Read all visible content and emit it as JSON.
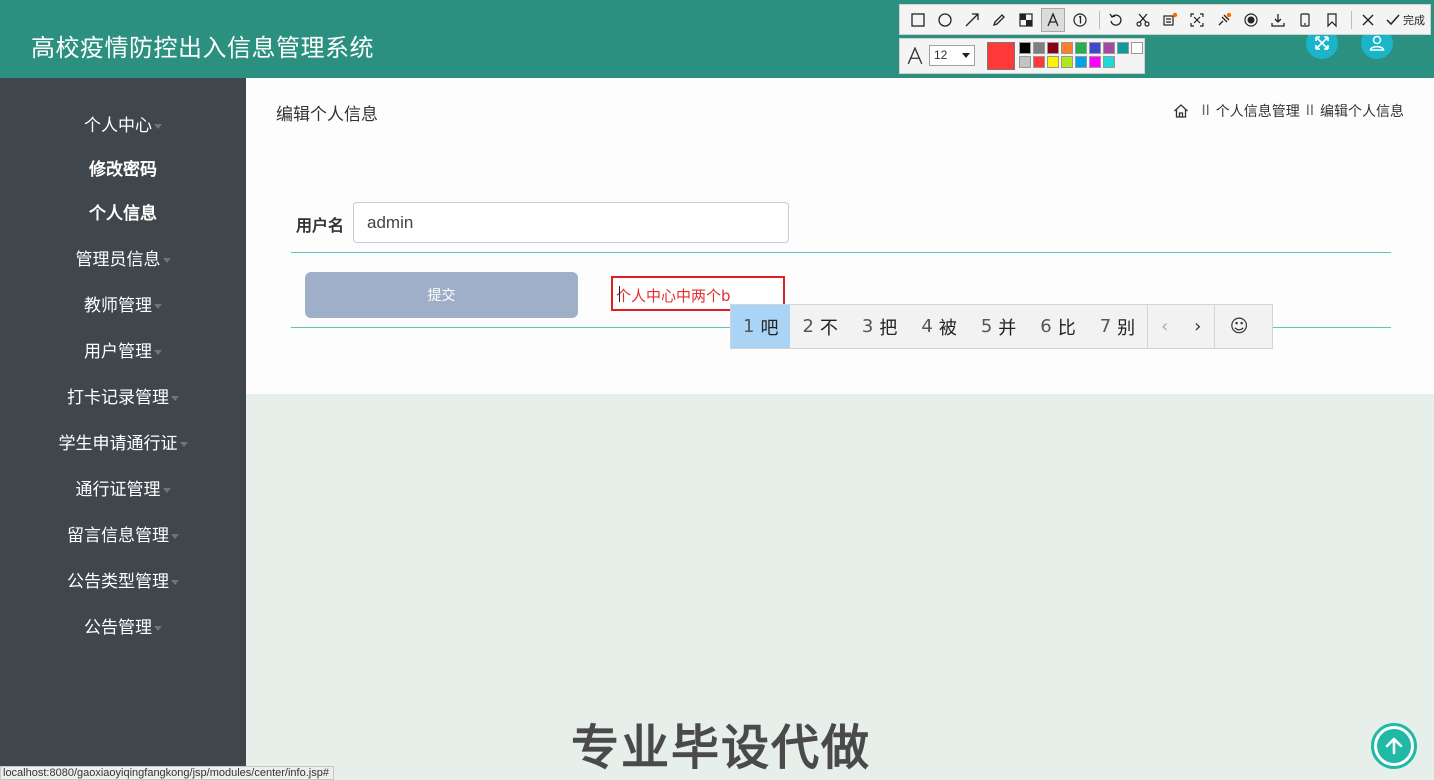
{
  "header": {
    "title": "高校疫情防控出入信息管理系统",
    "fullscreen_icon": "expand-arrows-icon",
    "user_icon": "user-icon"
  },
  "snip_toolbar": {
    "tools": [
      "rectangle-icon",
      "ellipse-icon",
      "arrow-icon",
      "pen-icon",
      "mosaic-icon",
      "text-icon",
      "number-icon",
      "undo-icon",
      "cut-icon",
      "ocr-icon",
      "scan-icon",
      "pin-icon",
      "record-icon",
      "download-icon",
      "phone-icon",
      "bookmark-icon"
    ],
    "done_label": "完成",
    "font_size": "12",
    "current_color": "#ff3838",
    "palette": [
      "#000000",
      "#7f7f7f",
      "#880015",
      "#ff7f27",
      "#22b14c",
      "#3f48cc",
      "#a349a4",
      "#0f9b9b",
      "#ffffff",
      "#c3c3c3",
      "#ff3838",
      "#fff200",
      "#b5e61d",
      "#00a2e8",
      "#ff00ff",
      "#1fd8d8"
    ]
  },
  "sidebar": {
    "items": [
      {
        "label": "个人中心",
        "caret": true,
        "sub": false
      },
      {
        "label": "修改密码",
        "caret": false,
        "sub": true
      },
      {
        "label": "个人信息",
        "caret": false,
        "sub": true
      },
      {
        "label": "管理员信息",
        "caret": true,
        "sub": false
      },
      {
        "label": "教师管理",
        "caret": true,
        "sub": false
      },
      {
        "label": "用户管理",
        "caret": true,
        "sub": false
      },
      {
        "label": "打卡记录管理",
        "caret": true,
        "sub": false
      },
      {
        "label": "学生申请通行证",
        "caret": true,
        "sub": false
      },
      {
        "label": "通行证管理",
        "caret": true,
        "sub": false
      },
      {
        "label": "留言信息管理",
        "caret": true,
        "sub": false
      },
      {
        "label": "公告类型管理",
        "caret": true,
        "sub": false
      },
      {
        "label": "公告管理",
        "caret": true,
        "sub": false
      }
    ]
  },
  "main": {
    "page_title": "编辑个人信息",
    "breadcrumb": [
      "个人信息管理",
      "编辑个人信息"
    ],
    "breadcrumb_sep": "II",
    "username_label": "用户名",
    "username_value": "admin",
    "submit_label": "提交"
  },
  "annotation": {
    "text": "个人中心中两个b"
  },
  "ime": {
    "candidates": [
      {
        "num": "1",
        "char": "吧"
      },
      {
        "num": "2",
        "char": "不"
      },
      {
        "num": "3",
        "char": "把"
      },
      {
        "num": "4",
        "char": "被"
      },
      {
        "num": "5",
        "char": "并"
      },
      {
        "num": "6",
        "char": "比"
      },
      {
        "num": "7",
        "char": "别"
      }
    ],
    "prev": "‹",
    "next": "›",
    "emoji": "☺"
  },
  "watermark": "专业毕设代做",
  "status_url": "localhost:8080/gaoxiaoyiqingfangkong/jsp/modules/center/info.jsp#"
}
